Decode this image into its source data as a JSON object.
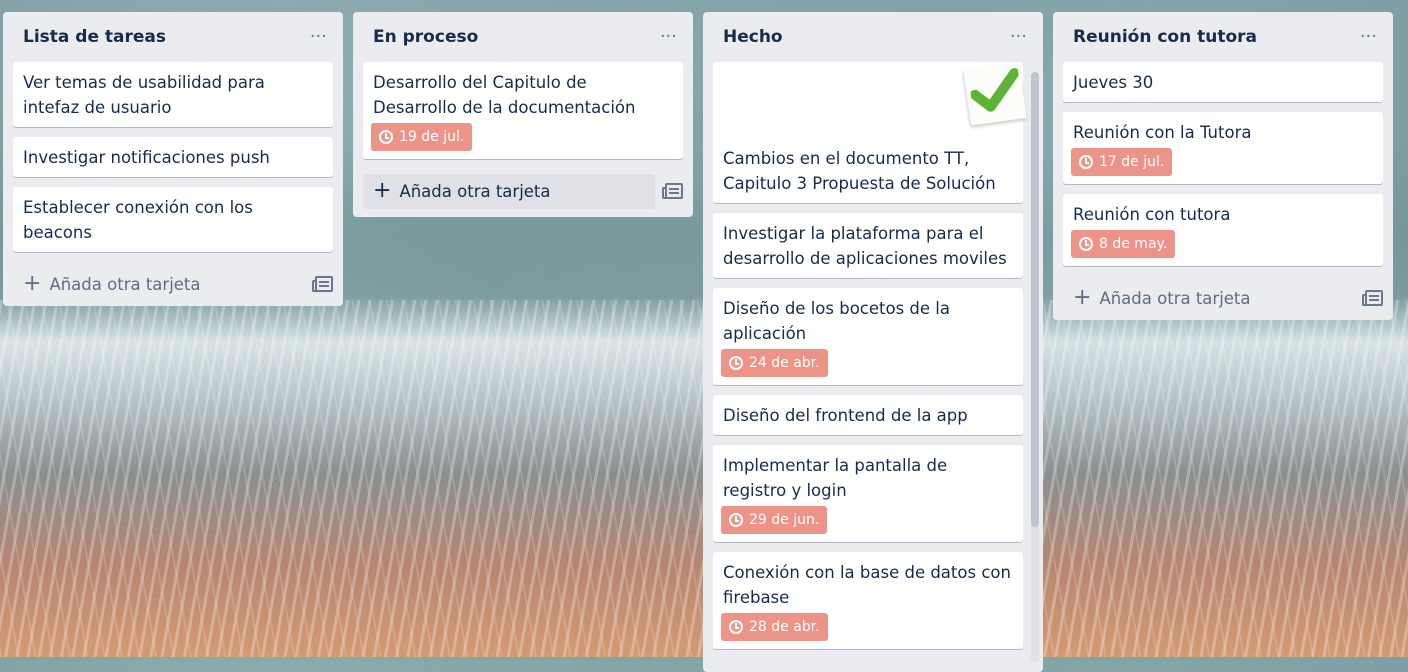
{
  "board": {
    "lists": [
      {
        "title": "Lista de tareas",
        "cards": [
          {
            "title": "Ver temas de usabilidad para intefaz de usuario"
          },
          {
            "title": "Investigar notificaciones push"
          },
          {
            "title": "Establecer conexión con los beacons"
          }
        ],
        "add_label": "Añada otra tarjeta"
      },
      {
        "title": "En proceso",
        "cards": [
          {
            "title": "Desarrollo del Capitulo de Desarrollo de la documentación",
            "due": "19 de jul."
          }
        ],
        "add_label": "Añada otra tarjeta"
      },
      {
        "title": "Hecho",
        "cards": [
          {
            "title": "Cambios en el documento TT, Capitulo 3 Propuesta de Solución",
            "cover_icon": "green-checkmark-icon"
          },
          {
            "title": "Investigar la plataforma para el desarrollo de aplicaciones moviles"
          },
          {
            "title": "Diseño de los bocetos de la aplicación",
            "due": "24 de abr."
          },
          {
            "title": "Diseño del frontend de la app"
          },
          {
            "title": "Implementar la pantalla de registro y login",
            "due": "29 de jun."
          },
          {
            "title": "Conexión con la base de datos con firebase",
            "due": "28 de abr."
          }
        ]
      },
      {
        "title": "Reunión con tutora",
        "cards": [
          {
            "title": "Jueves 30"
          },
          {
            "title": "Reunión con la Tutora",
            "due": "17 de jul."
          },
          {
            "title": "Reunión con tutora",
            "due": "8 de may."
          }
        ],
        "add_label": "Añada otra tarjeta"
      }
    ],
    "icons": {
      "menu": "ellipsis-icon",
      "add": "plus-icon",
      "template": "card-template-icon",
      "due": "clock-icon"
    },
    "colors": {
      "list_bg": "#ebecf0",
      "due_badge": "#ec9488",
      "text": "#172b4d"
    }
  }
}
